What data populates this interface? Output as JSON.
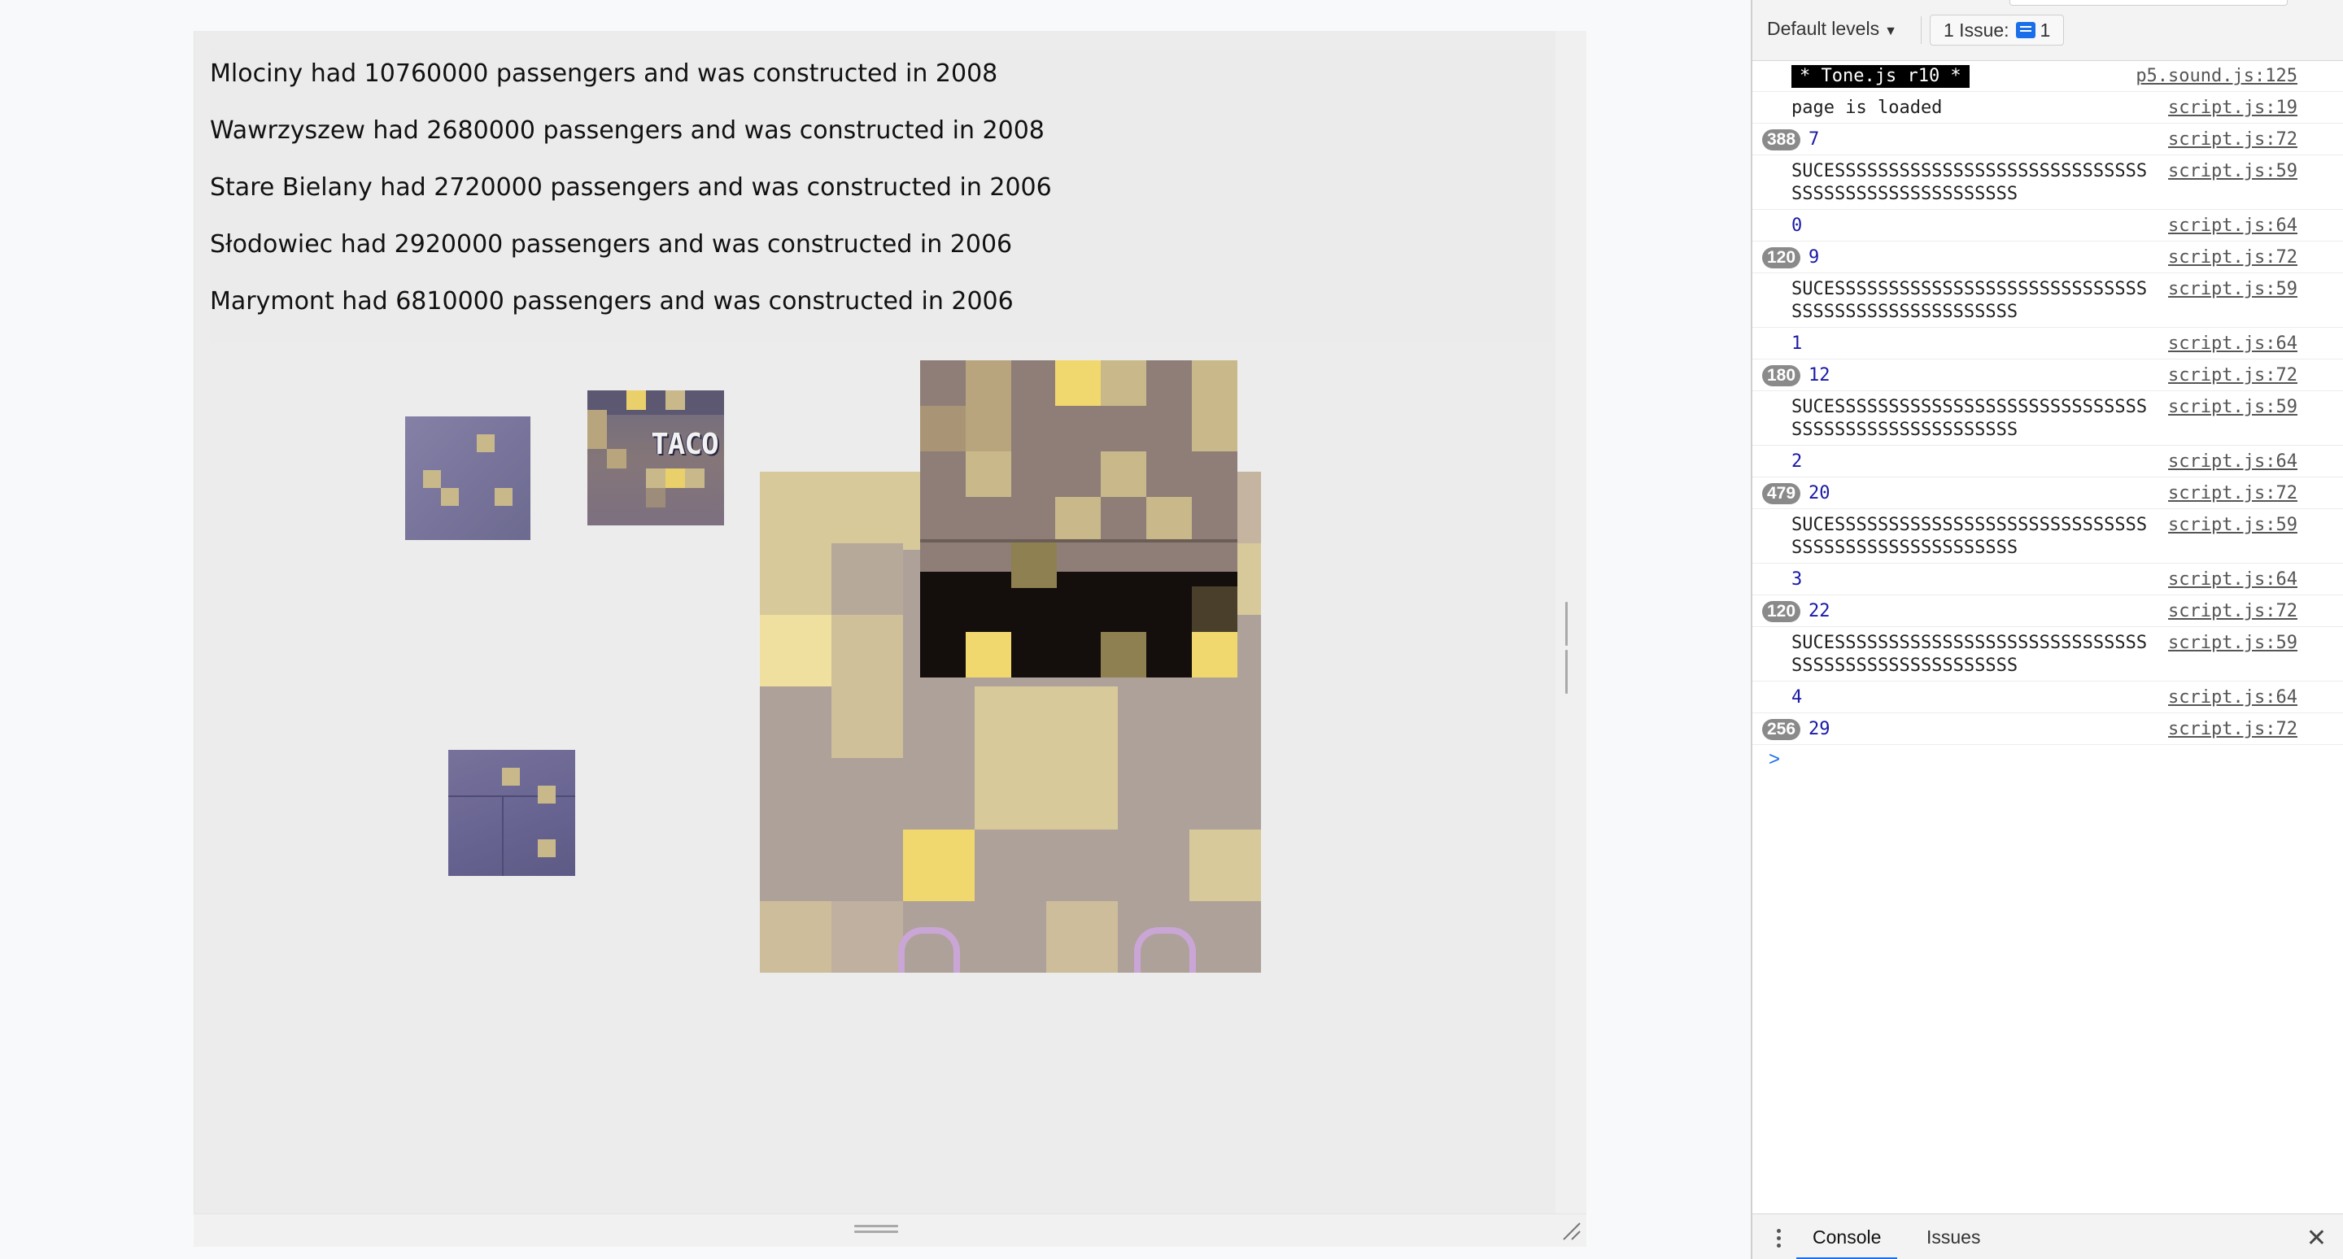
{
  "stations": [
    {
      "text": "Mlociny had 10760000 passengers and was constructed in 2008"
    },
    {
      "text": "Wawrzyszew had 2680000 passengers and was constructed in 2008"
    },
    {
      "text": "Stare Bielany had 2720000 passengers and was constructed in 2006"
    },
    {
      "text": "Słodowiec had 2920000 passengers and was constructed in 2006"
    },
    {
      "text": "Marymont had 6810000 passengers and was constructed in 2006"
    }
  ],
  "tile_text": "TACO",
  "devtools": {
    "levels_label": "Default levels",
    "levels_arrow": "▼",
    "issue_label": "1 Issue:",
    "issue_count": "1",
    "tabs": {
      "console": "Console",
      "issues": "Issues"
    },
    "close_glyph": "✕",
    "prompt_glyph": ">",
    "console": [
      {
        "badge": "",
        "message": "* Tone.js r10 *",
        "source": "p5.sound.js:125"
      },
      {
        "badge": "",
        "message": "page is loaded",
        "source": "script.js:19"
      },
      {
        "badge": "388",
        "message": "7",
        "source": "script.js:72"
      },
      {
        "badge": "",
        "message": "SUCESSSSSSSSSSSSSSSSSSSSSSSSSSSSSSSSSSSSSSSSSSSSSSSSSS",
        "source": "script.js:59"
      },
      {
        "badge": "",
        "message": "0",
        "source": "script.js:64"
      },
      {
        "badge": "120",
        "message": "9",
        "source": "script.js:72"
      },
      {
        "badge": "",
        "message": "SUCESSSSSSSSSSSSSSSSSSSSSSSSSSSSSSSSSSSSSSSSSSSSSSSSSS",
        "source": "script.js:59"
      },
      {
        "badge": "",
        "message": "1",
        "source": "script.js:64"
      },
      {
        "badge": "180",
        "message": "12",
        "source": "script.js:72"
      },
      {
        "badge": "",
        "message": "SUCESSSSSSSSSSSSSSSSSSSSSSSSSSSSSSSSSSSSSSSSSSSSSSSSSS",
        "source": "script.js:59"
      },
      {
        "badge": "",
        "message": "2",
        "source": "script.js:64"
      },
      {
        "badge": "479",
        "message": "20",
        "source": "script.js:72"
      },
      {
        "badge": "",
        "message": "SUCESSSSSSSSSSSSSSSSSSSSSSSSSSSSSSSSSSSSSSSSSSSSSSSSSS",
        "source": "script.js:59"
      },
      {
        "badge": "",
        "message": "3",
        "source": "script.js:64"
      },
      {
        "badge": "120",
        "message": "22",
        "source": "script.js:72"
      },
      {
        "badge": "",
        "message": "SUCESSSSSSSSSSSSSSSSSSSSSSSSSSSSSSSSSSSSSSSSSSSSSSSSSS",
        "source": "script.js:59"
      },
      {
        "badge": "",
        "message": "4",
        "source": "script.js:64"
      },
      {
        "badge": "256",
        "message": "29",
        "source": "script.js:72"
      }
    ]
  },
  "colors": {
    "accent": "#1a6fe8",
    "pixel_yellow": "#e9d06a",
    "pixel_tan": "#c9b98a"
  }
}
